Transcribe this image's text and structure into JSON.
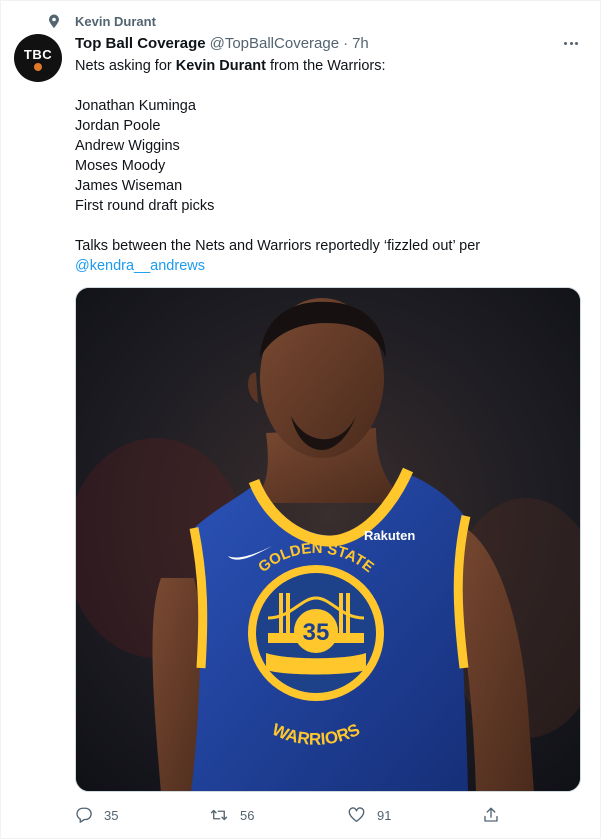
{
  "social_context": {
    "text": "Kevin Durant"
  },
  "author": {
    "avatar_text": "TBC",
    "display_name": "Top Ball Coverage",
    "handle": "@TopBallCoverage",
    "separator": "·",
    "time": "7h"
  },
  "tweet": {
    "line1_pre": "Nets asking for ",
    "line1_bold": "Kevin Durant",
    "line1_post": " from the Warriors:",
    "list": [
      "Jonathan Kuminga",
      "Jordan Poole",
      "Andrew Wiggins",
      "Moses Moody",
      "James Wiseman",
      "First round draft picks"
    ],
    "talks": "Talks between the Nets and Warriors reportedly ‘fizzled out’ per",
    "mention": "@kendra__andrews"
  },
  "media": {
    "jersey_sponsor": "Rakuten",
    "jersey_arc": "GOLDEN STATE",
    "jersey_number": "35",
    "jersey_team": "WARRIORS"
  },
  "actions": {
    "replies": "35",
    "retweets": "56",
    "likes": "91"
  },
  "colors": {
    "link": "#1d9bf0",
    "secondary_text": "#536471",
    "jersey_blue": "#1d428a",
    "jersey_gold": "#ffc72c"
  }
}
